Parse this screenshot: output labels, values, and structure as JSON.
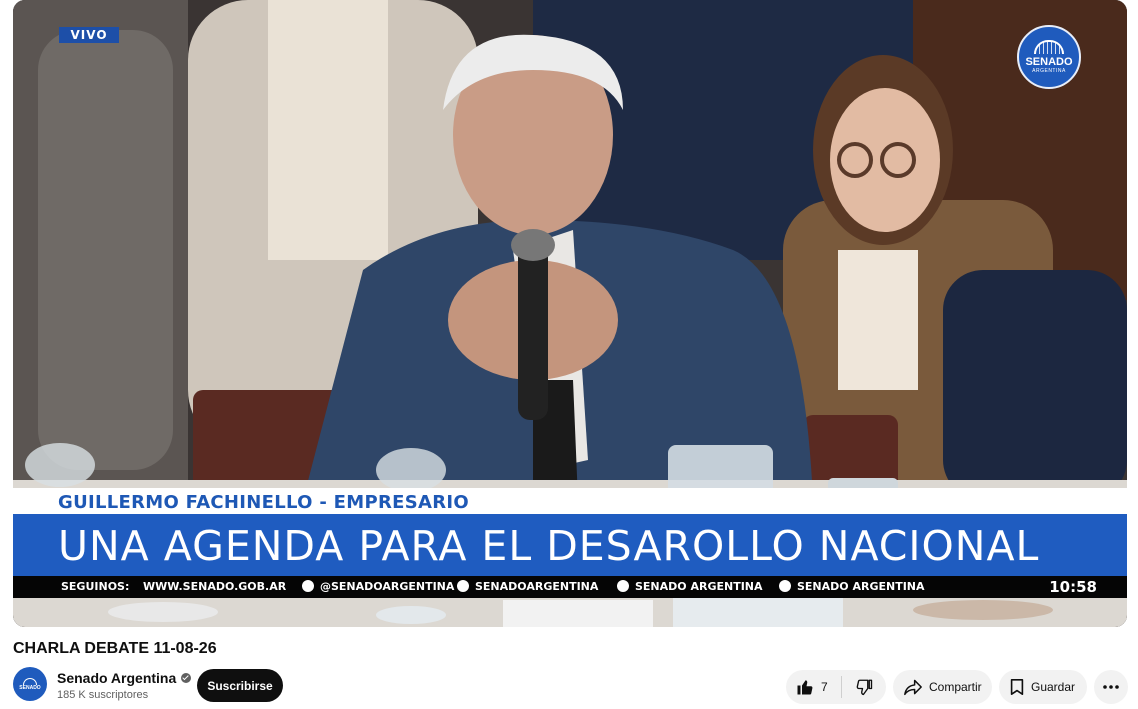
{
  "player": {
    "live_label": "VIVO",
    "logo": {
      "line1": "SENADO",
      "line2": "ARGENTINA"
    },
    "lower_third": {
      "name": "GUILLERMO FACHINELLO - EMPRESARIO",
      "headline": "UNA AGENDA PARA EL DESAROLLO NACIONAL",
      "follow_label": "SEGUINOS:",
      "website": "WWW.SENADO.GOB.AR",
      "socials": [
        "@SENADOARGENTINA",
        "SENADOARGENTINA",
        "SENADO ARGENTINA",
        "SENADO ARGENTINA"
      ],
      "clock": "10:58"
    }
  },
  "video": {
    "title": "CHARLA DEBATE 11-08-26"
  },
  "channel": {
    "avatar_text": "SENADO",
    "name": "Senado Argentina",
    "subscribers": "185 K suscriptores",
    "subscribe_label": "Suscribirse"
  },
  "actions": {
    "like_count": "7",
    "share_label": "Compartir",
    "save_label": "Guardar"
  },
  "colors": {
    "brand_blue": "#1f5cc0",
    "subscribe_bg": "#0f0f0f",
    "pill_bg": "#f2f2f2"
  }
}
